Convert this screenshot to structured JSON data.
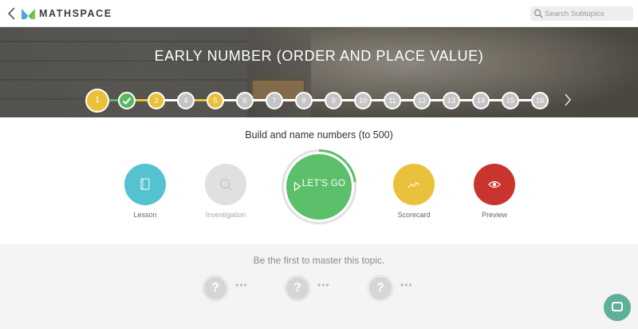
{
  "app": {
    "name": "MATHSPACE",
    "brand_color": "#58b85f"
  },
  "search": {
    "placeholder": "Search Subtopics"
  },
  "banner": {
    "title": "EARLY NUMBER (ORDER AND PLACE VALUE)"
  },
  "steps": [
    {
      "label": "1",
      "state": "current"
    },
    {
      "label": "",
      "state": "done"
    },
    {
      "label": "3",
      "state": "yellow"
    },
    {
      "label": "4",
      "state": "grey"
    },
    {
      "label": "5",
      "state": "yellow"
    },
    {
      "label": "6",
      "state": "grey"
    },
    {
      "label": "7",
      "state": "grey"
    },
    {
      "label": "8",
      "state": "grey"
    },
    {
      "label": "9",
      "state": "grey"
    },
    {
      "label": "10",
      "state": "grey"
    },
    {
      "label": "11",
      "state": "grey"
    },
    {
      "label": "12",
      "state": "grey"
    },
    {
      "label": "13",
      "state": "grey"
    },
    {
      "label": "14",
      "state": "grey"
    },
    {
      "label": "15",
      "state": "grey"
    },
    {
      "label": "16",
      "state": "grey"
    }
  ],
  "subtopic": {
    "title": "Build and name numbers (to 500)"
  },
  "actions": {
    "lesson": {
      "label": "Lesson",
      "color": "#55c3cf",
      "icon": "book-icon"
    },
    "investigation": {
      "label": "Investigation",
      "color": "#e0e0e0",
      "icon": "magnifier-icon"
    },
    "lets_go": {
      "label": "LET'S GO",
      "color": "#5cc06b",
      "icon": "play-icon"
    },
    "scorecard": {
      "label": "Scorecard",
      "color": "#eac13b",
      "icon": "trend-icon"
    },
    "preview": {
      "label": "Preview",
      "color": "#c9342f",
      "icon": "eye-icon"
    }
  },
  "leaderboard": {
    "message": "Be the first to master this topic.",
    "slot_symbol": "?",
    "more": "•••"
  }
}
